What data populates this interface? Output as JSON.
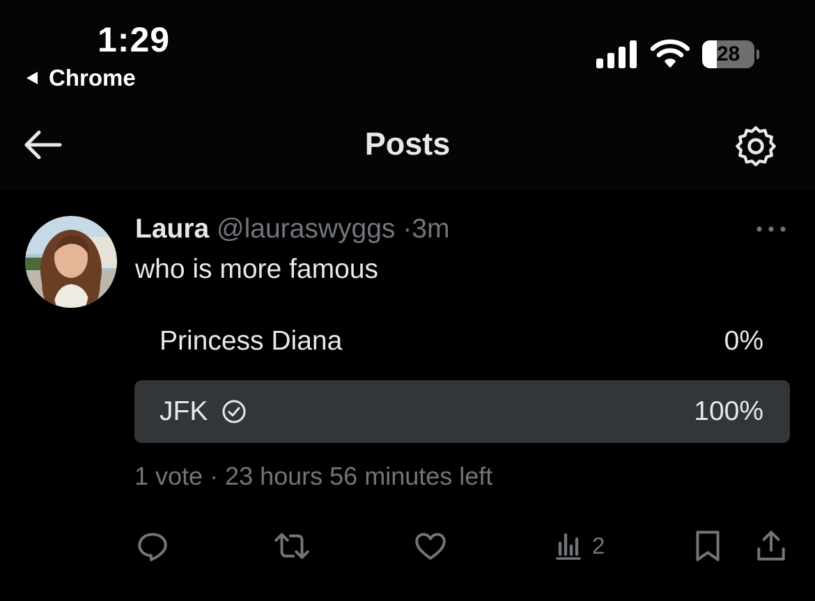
{
  "status_bar": {
    "time": "1:29",
    "back_app": "Chrome",
    "battery_level": "28",
    "battery_fraction": 0.28,
    "icons": [
      "signal-icon",
      "wifi-icon",
      "battery-icon"
    ]
  },
  "header": {
    "title": "Posts",
    "back_icon": "arrow-left-icon",
    "settings_icon": "gear-icon"
  },
  "post": {
    "author_name": "Laura",
    "author_handle": "@lauraswyggs",
    "separator": "·",
    "time": "3m",
    "text": "who is more famous",
    "more_icon": "ellipsis-icon",
    "poll": {
      "options": [
        {
          "label": "Princess Diana",
          "percent_label": "0%",
          "percent": 0,
          "selected": false
        },
        {
          "label": "JFK",
          "percent_label": "100%",
          "percent": 100,
          "selected": true
        }
      ],
      "summary": "1 vote · 23 hours 56 minutes left"
    },
    "actions": {
      "reply_icon": "reply-icon",
      "repost_icon": "repost-icon",
      "like_icon": "heart-icon",
      "views_icon": "views-icon",
      "views_count": "2",
      "bookmark_icon": "bookmark-icon",
      "share_icon": "share-icon"
    }
  },
  "colors": {
    "background": "#000000",
    "bar_background": "#050505",
    "text_primary": "#e7e9ea",
    "text_secondary": "#71767b",
    "poll_fill": "#333639"
  }
}
